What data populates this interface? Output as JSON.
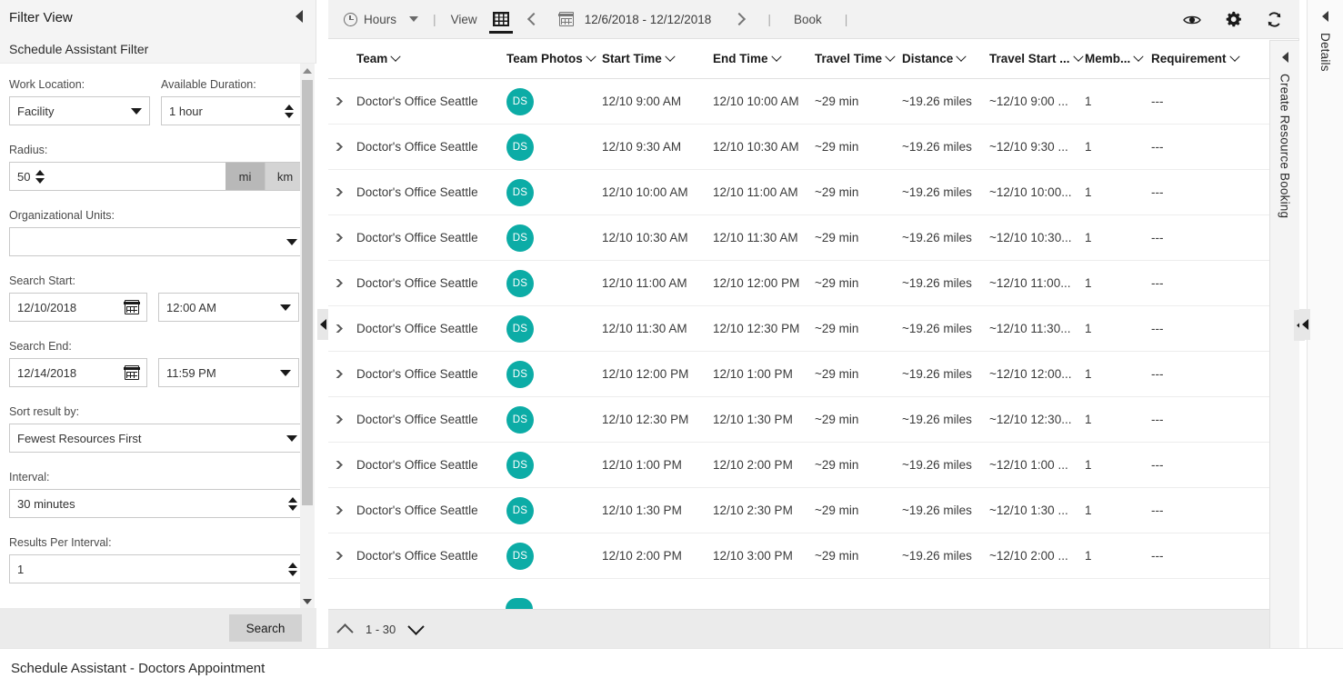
{
  "filter_panel": {
    "header_title": "Filter View",
    "subheader_title": "Schedule Assistant Filter",
    "collapse_icon": "caret-left-icon",
    "fields": {
      "work_location_label": "Work Location:",
      "work_location_value": "Facility",
      "available_duration_label": "Available Duration:",
      "available_duration_value": "1 hour",
      "radius_label": "Radius:",
      "radius_value": "50",
      "unit_mi": "mi",
      "unit_km": "km",
      "unit_selected": "mi",
      "organizational_units_label": "Organizational Units:",
      "organizational_units_value": "",
      "search_start_label": "Search Start:",
      "search_start_date": "12/10/2018",
      "search_start_time": "12:00 AM",
      "search_end_label": "Search End:",
      "search_end_date": "12/14/2018",
      "search_end_time": "11:59 PM",
      "sort_result_by_label": "Sort result by:",
      "sort_result_by_value": "Fewest Resources First",
      "interval_label": "Interval:",
      "interval_value": "30 minutes",
      "results_per_interval_label": "Results Per Interval:",
      "results_per_interval_value": "1"
    },
    "search_button": "Search"
  },
  "toolbar": {
    "hours_label": "Hours",
    "hours_icon": "clock-icon",
    "view_label": "View",
    "grid_view_icon": "grid-icon",
    "prev_icon": "chevron-left-icon",
    "calendar_icon": "calendar-icon",
    "date_range": "12/6/2018 - 12/12/2018",
    "next_icon": "chevron-right-icon",
    "book_label": "Book",
    "separator": "|",
    "eye_icon": "eye-icon",
    "gear_icon": "gear-icon",
    "refresh_icon": "refresh-icon"
  },
  "grid": {
    "columns": [
      {
        "key": "team",
        "label": "Team"
      },
      {
        "key": "team_photos",
        "label": "Team Photos"
      },
      {
        "key": "start_time",
        "label": "Start Time"
      },
      {
        "key": "end_time",
        "label": "End Time"
      },
      {
        "key": "travel_time",
        "label": "Travel Time"
      },
      {
        "key": "distance",
        "label": "Distance"
      },
      {
        "key": "travel_start",
        "label": "Travel Start ..."
      },
      {
        "key": "members",
        "label": "Memb..."
      },
      {
        "key": "requirement",
        "label": "Requirement"
      }
    ],
    "rows": [
      {
        "team": "Doctor's Office Seattle",
        "avatar": "DS",
        "start_time": "12/10 9:00 AM",
        "end_time": "12/10 10:00 AM",
        "travel_time": "~29 min",
        "distance": "~19.26 miles",
        "travel_start": "~12/10 9:00 ...",
        "members": "1",
        "requirement": "---"
      },
      {
        "team": "Doctor's Office Seattle",
        "avatar": "DS",
        "start_time": "12/10 9:30 AM",
        "end_time": "12/10 10:30 AM",
        "travel_time": "~29 min",
        "distance": "~19.26 miles",
        "travel_start": "~12/10 9:30 ...",
        "members": "1",
        "requirement": "---"
      },
      {
        "team": "Doctor's Office Seattle",
        "avatar": "DS",
        "start_time": "12/10 10:00 AM",
        "end_time": "12/10 11:00 AM",
        "travel_time": "~29 min",
        "distance": "~19.26 miles",
        "travel_start": "~12/10 10:00...",
        "members": "1",
        "requirement": "---"
      },
      {
        "team": "Doctor's Office Seattle",
        "avatar": "DS",
        "start_time": "12/10 10:30 AM",
        "end_time": "12/10 11:30 AM",
        "travel_time": "~29 min",
        "distance": "~19.26 miles",
        "travel_start": "~12/10 10:30...",
        "members": "1",
        "requirement": "---"
      },
      {
        "team": "Doctor's Office Seattle",
        "avatar": "DS",
        "start_time": "12/10 11:00 AM",
        "end_time": "12/10 12:00 PM",
        "travel_time": "~29 min",
        "distance": "~19.26 miles",
        "travel_start": "~12/10 11:00...",
        "members": "1",
        "requirement": "---"
      },
      {
        "team": "Doctor's Office Seattle",
        "avatar": "DS",
        "start_time": "12/10 11:30 AM",
        "end_time": "12/10 12:30 PM",
        "travel_time": "~29 min",
        "distance": "~19.26 miles",
        "travel_start": "~12/10 11:30...",
        "members": "1",
        "requirement": "---"
      },
      {
        "team": "Doctor's Office Seattle",
        "avatar": "DS",
        "start_time": "12/10 12:00 PM",
        "end_time": "12/10 1:00 PM",
        "travel_time": "~29 min",
        "distance": "~19.26 miles",
        "travel_start": "~12/10 12:00...",
        "members": "1",
        "requirement": "---"
      },
      {
        "team": "Doctor's Office Seattle",
        "avatar": "DS",
        "start_time": "12/10 12:30 PM",
        "end_time": "12/10 1:30 PM",
        "travel_time": "~29 min",
        "distance": "~19.26 miles",
        "travel_start": "~12/10 12:30...",
        "members": "1",
        "requirement": "---"
      },
      {
        "team": "Doctor's Office Seattle",
        "avatar": "DS",
        "start_time": "12/10 1:00 PM",
        "end_time": "12/10 2:00 PM",
        "travel_time": "~29 min",
        "distance": "~19.26 miles",
        "travel_start": "~12/10 1:00 ...",
        "members": "1",
        "requirement": "---"
      },
      {
        "team": "Doctor's Office Seattle",
        "avatar": "DS",
        "start_time": "12/10 1:30 PM",
        "end_time": "12/10 2:30 PM",
        "travel_time": "~29 min",
        "distance": "~19.26 miles",
        "travel_start": "~12/10 1:30 ...",
        "members": "1",
        "requirement": "---"
      },
      {
        "team": "Doctor's Office Seattle",
        "avatar": "DS",
        "start_time": "12/10 2:00 PM",
        "end_time": "12/10 3:00 PM",
        "travel_time": "~29 min",
        "distance": "~19.26 miles",
        "travel_start": "~12/10 2:00 ...",
        "members": "1",
        "requirement": "---"
      }
    ],
    "pager_range": "1 - 30",
    "pager_up_icon": "chevron-up-icon",
    "pager_down_icon": "chevron-down-icon"
  },
  "rails": {
    "create_resource_booking": "Create Resource Booking",
    "details": "Details",
    "collapse_icon": "caret-left-icon"
  },
  "statusbar": {
    "text": "Schedule Assistant - Doctors Appointment"
  },
  "colors": {
    "accent_teal": "#0caca6",
    "toolbar_bg": "#f2f2f2",
    "panel_header_bg": "#f4f4f4",
    "footer_bg": "#ebebeb"
  }
}
